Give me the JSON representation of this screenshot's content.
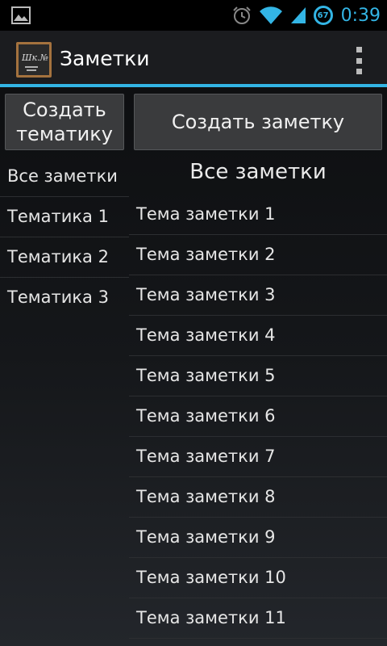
{
  "status_bar": {
    "time": "0:39",
    "battery_level": "67"
  },
  "action_bar": {
    "app_icon_text": "Шк.№",
    "title": "Заметки"
  },
  "buttons": {
    "create_topic": "Создать тематику",
    "create_note": "Создать заметку"
  },
  "topics": [
    "Все заметки",
    "Тематика 1",
    "Тематика 2",
    "Тематика 3"
  ],
  "notes_list": {
    "header": "Все заметки",
    "items": [
      "Тема заметки 1",
      "Тема заметки 2",
      "Тема заметки 3",
      "Тема заметки 4",
      "Тема заметки 5",
      "Тема заметки 6",
      "Тема заметки 7",
      "Тема заметки 8",
      "Тема заметки 9",
      "Тема заметки 10",
      "Тема заметки 11"
    ]
  },
  "colors": {
    "accent": "#33b5e5"
  }
}
